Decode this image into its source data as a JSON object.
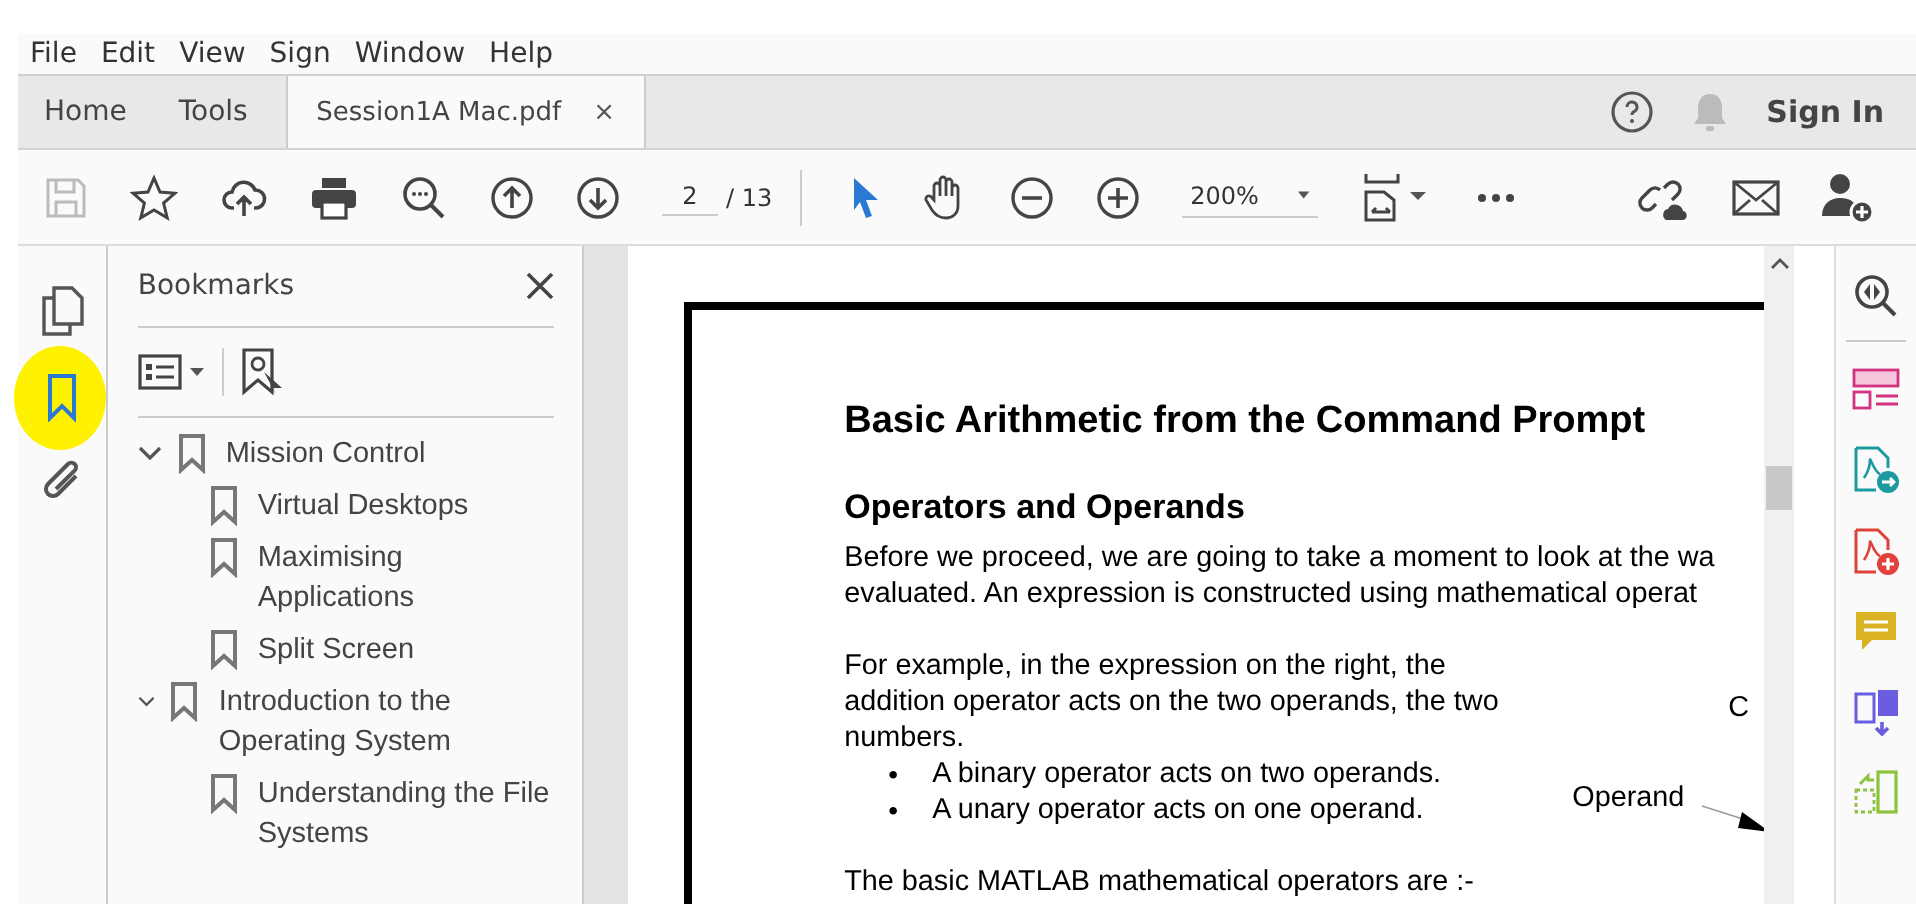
{
  "menu": [
    "File",
    "Edit",
    "View",
    "Sign",
    "Window",
    "Help"
  ],
  "tabs": [
    {
      "label": "Home",
      "selected": false
    },
    {
      "label": "Tools",
      "selected": false
    },
    {
      "label": "Session1A Mac.pdf",
      "selected": true,
      "close": "×"
    }
  ],
  "account": {
    "sign_in": "Sign In"
  },
  "toolbar": {
    "page": "2",
    "page_total": "/ 13",
    "zoom": "200%"
  },
  "rail": [
    {
      "kind": "pages",
      "selected": false
    },
    {
      "kind": "bookmark",
      "selected": true
    },
    {
      "kind": "attachment",
      "selected": false
    }
  ],
  "bookmarks": {
    "title": "Bookmarks",
    "items": [
      {
        "label": "Mission Control",
        "expanded": true,
        "children": [
          {
            "label": "Virtual Desktops"
          },
          {
            "label": "Maximising Applications"
          },
          {
            "label": "Split Screen"
          }
        ]
      },
      {
        "label": "Introduction to the Operating System",
        "expanded": true,
        "children": [
          {
            "label": "Understanding the File Systems"
          }
        ]
      }
    ]
  },
  "document": {
    "title": "Basic Arithmetic from the Command Prompt",
    "heading": "Operators and Operands",
    "intro": [
      "Before we proceed, we are going to take a moment to look at the wa",
      "evaluated.  An expression is constructed using mathematical operat"
    ],
    "example": [
      "For example, in the expression on the right, the",
      "addition operator acts on the two operands, the two",
      "numbers."
    ],
    "bullets": [
      "A binary operator acts on two operands.",
      "A unary operator acts on one operand."
    ],
    "bullet_mark": "•",
    "last_line": "The basic MATLAB mathematical operators are :-",
    "figure": {
      "label_1": "C",
      "label_2": "Operand"
    }
  }
}
